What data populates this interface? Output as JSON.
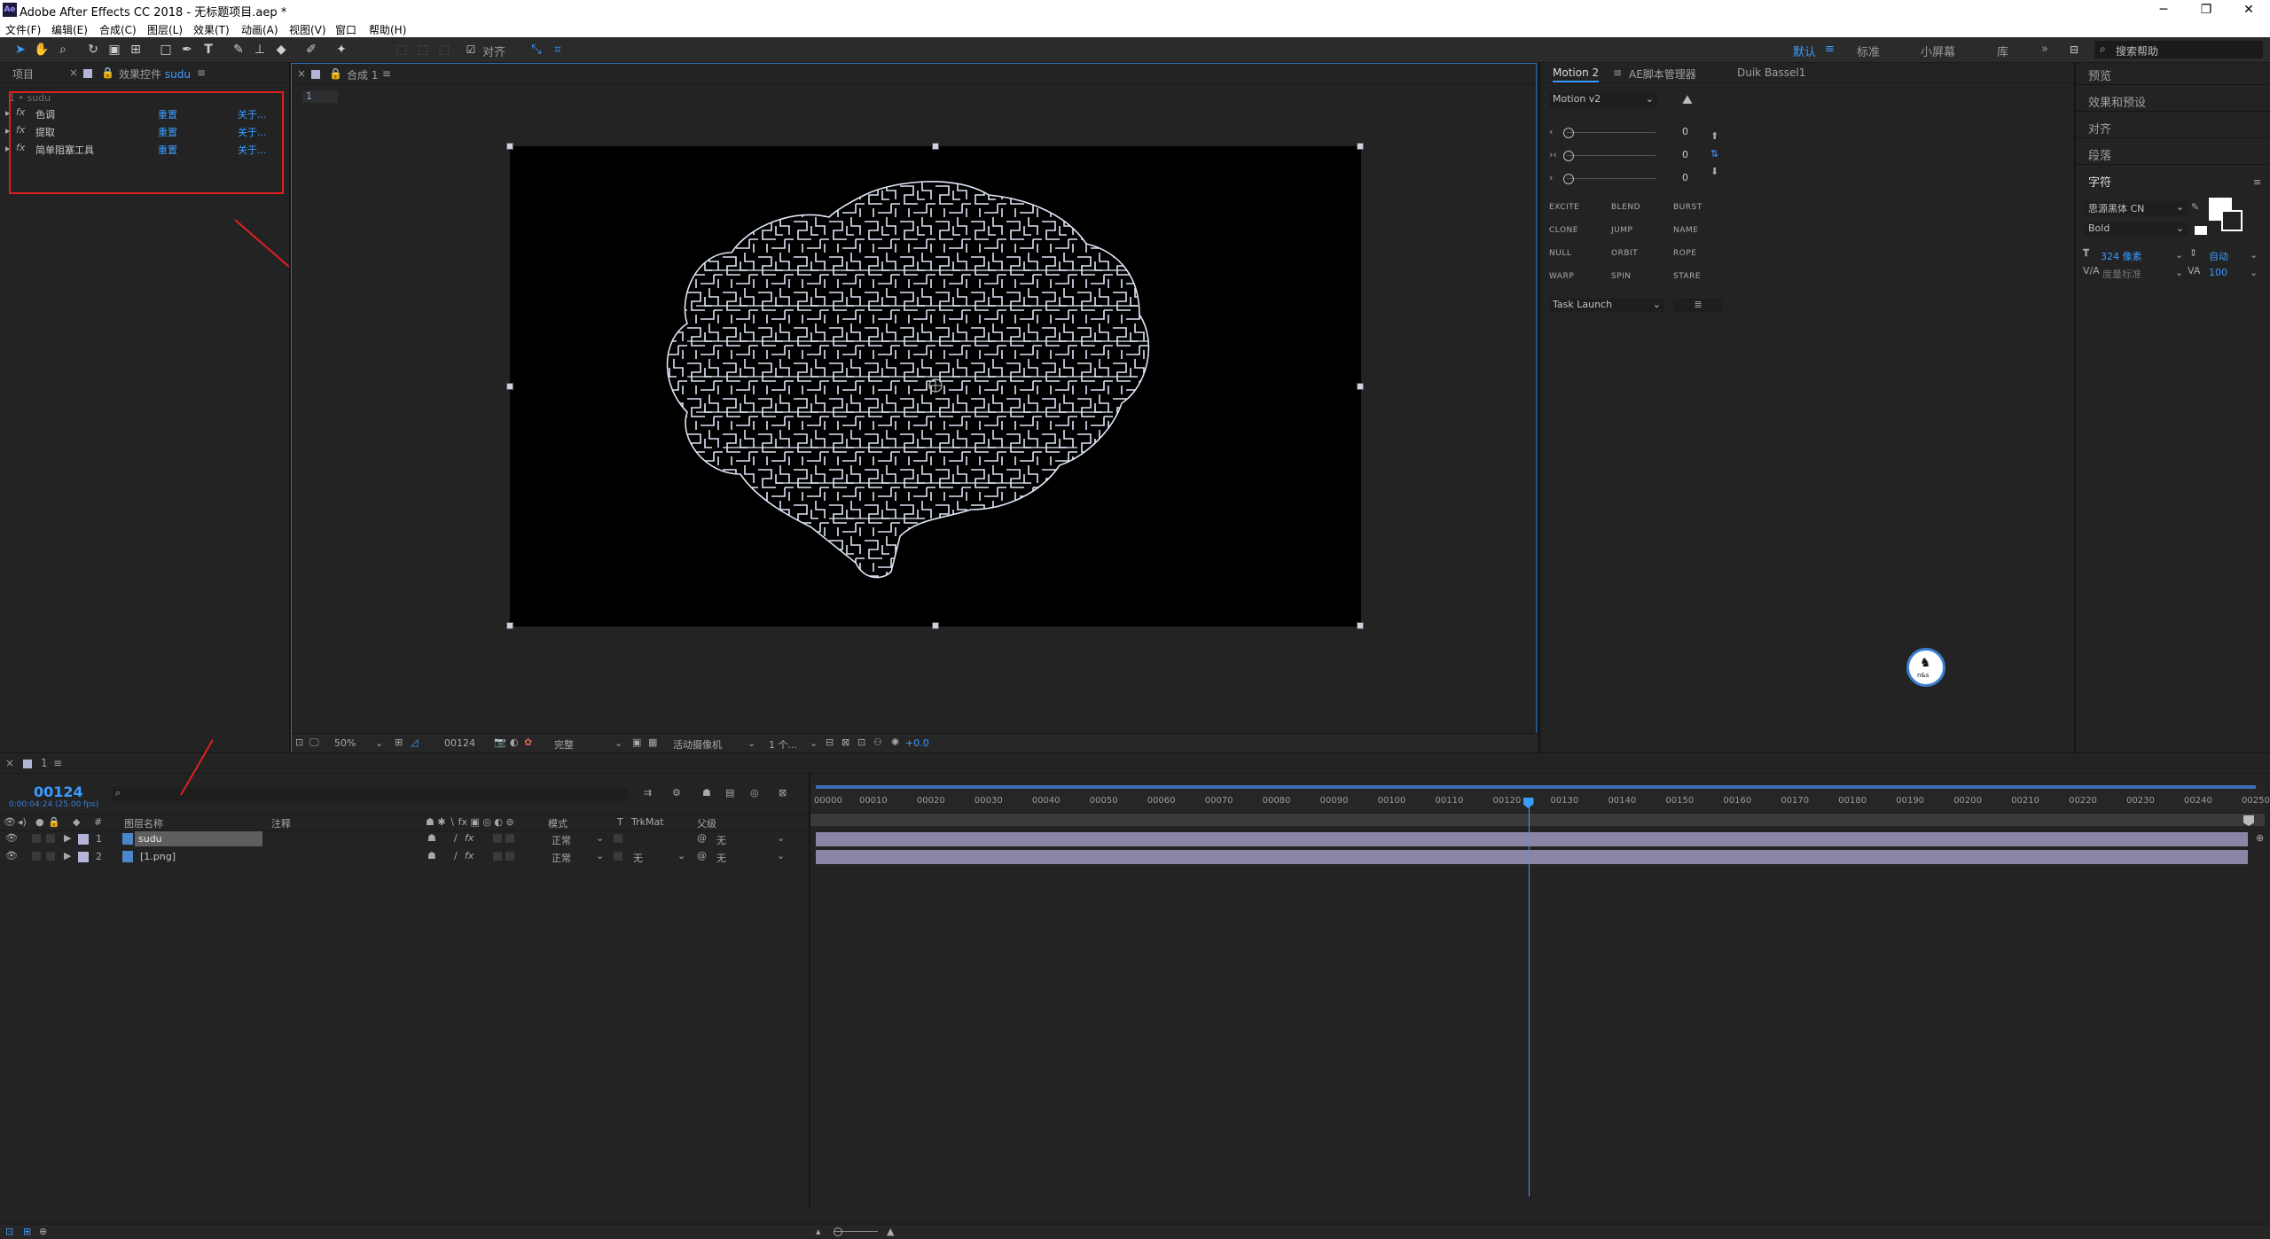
{
  "window": {
    "title": "Adobe After Effects CC 2018 - 无标题项目.aep *",
    "app_icon": "Ae",
    "minimize": "─",
    "maximize": "❐",
    "close": "✕"
  },
  "menu": [
    "文件(F)",
    "编辑(E)",
    "合成(C)",
    "图层(L)",
    "效果(T)",
    "动画(A)",
    "视图(V)",
    "窗口",
    "帮助(H)"
  ],
  "toolbar": {
    "snap_label": "对齐",
    "workspaces": [
      "默认",
      "标准",
      "小屏幕",
      "库"
    ],
    "active_workspace_icon": "≡",
    "more": "»",
    "help_placeholder": "搜索帮助"
  },
  "project_panel": {
    "tabs": [
      "项目",
      "效果控件 sudu"
    ],
    "effect_controls_prefix": "效果控件",
    "effect_controls_layer": "sudu",
    "layer_label": "1 • sudu",
    "effects": [
      {
        "fx": "fx",
        "name": "色调",
        "reset": "重置",
        "about": "关于..."
      },
      {
        "fx": "fx",
        "name": "提取",
        "reset": "重置",
        "about": "关于..."
      },
      {
        "fx": "fx",
        "name": "简单阻塞工具",
        "reset": "重置",
        "about": "关于..."
      }
    ]
  },
  "composition_panel": {
    "tab": "合成 1",
    "flow_tab": "1",
    "footer": {
      "zoom": "50%",
      "timecode": "00124",
      "resolution": "完整",
      "camera": "活动摄像机",
      "views": "1 个...",
      "exposure": "+0.0"
    }
  },
  "motion_panel": {
    "tabs": [
      "Motion 2",
      "AE脚本管理器",
      "Duik Bassel1"
    ],
    "preset": "Motion v2",
    "sliders": [
      {
        "icon": "‹",
        "value": "0"
      },
      {
        "icon": "›‹",
        "value": "0"
      },
      {
        "icon": "›",
        "value": "0"
      }
    ],
    "buttons": [
      "EXCITE",
      "BLEND",
      "BURST",
      "CLONE",
      "JUMP",
      "NAME",
      "NULL",
      "ORBIT",
      "ROPE",
      "WARP",
      "SPIN",
      "STARE"
    ],
    "task_launch": "Task Launch",
    "task_button": "≣"
  },
  "right_sidebar": {
    "items": [
      "预览",
      "效果和预设",
      "对齐",
      "段落",
      "字符"
    ],
    "character": {
      "font": "思源黑体 CN",
      "style": "Bold",
      "size": "324 像素",
      "leading": "自动",
      "kerning": "度量标准",
      "tracking": "100"
    }
  },
  "floating_badge": {
    "text": "n&s"
  },
  "timeline": {
    "tab": "1",
    "timecode": "00124",
    "timecode_sub": "0:00:04:24 (25.00 fps)",
    "columns": {
      "name": "图层名称",
      "comment": "注释",
      "mode": "模式",
      "t": "T",
      "trkmat": "TrkMat",
      "parent": "父级"
    },
    "layers": [
      {
        "index": "1",
        "name": "sudu",
        "mode": "正常",
        "trkmat": "",
        "parent": "无"
      },
      {
        "index": "2",
        "name": "[1.png]",
        "mode": "正常",
        "trkmat": "无",
        "parent": "无"
      }
    ],
    "ruler": [
      "00000",
      "00010",
      "00020",
      "00030",
      "00040",
      "00050",
      "00060",
      "00070",
      "00080",
      "00090",
      "00100",
      "00110",
      "00120",
      "00130",
      "00140",
      "00150",
      "00160",
      "00170",
      "00180",
      "00190",
      "00200",
      "00210",
      "00220",
      "00230",
      "00240",
      "00250"
    ],
    "playhead_frame": 124,
    "ruler_max_frame": 250
  },
  "colors": {
    "accent": "#3b9cff",
    "highlight_red": "#e02020",
    "bar": "#8a86a6",
    "maze": "#dfe6f5"
  }
}
